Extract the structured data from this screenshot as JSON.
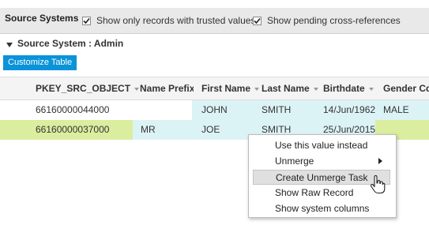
{
  "header": {
    "title": "Source Systems",
    "checkbox_trusted_label": "Show only records with trusted values",
    "checkbox_pending_label": "Show pending cross-references"
  },
  "section": {
    "label": "Source System : Admin"
  },
  "toolbar": {
    "customize_label": "Customize Table"
  },
  "table": {
    "columns": [
      "PKEY_SRC_OBJECT",
      "Name Prefix",
      "First Name",
      "Last Name",
      "Birthdate",
      "Gender Cd"
    ],
    "rows": [
      [
        "66160000044000",
        "",
        "JOHN",
        "SMITH",
        "14/Jun/1962",
        "MALE"
      ],
      [
        "66160000037000",
        "MR",
        "JOE",
        "SMITH",
        "25/Jun/2015",
        ""
      ]
    ]
  },
  "context_menu": {
    "items": [
      "Use this value instead",
      "Unmerge",
      "Create Unmerge Task",
      "Show Raw Record",
      "Show system columns"
    ]
  },
  "colors": {
    "accent": "#0a93d8",
    "selected_row": "#dbed9f",
    "highlight_cell": "#dcf3f6"
  }
}
